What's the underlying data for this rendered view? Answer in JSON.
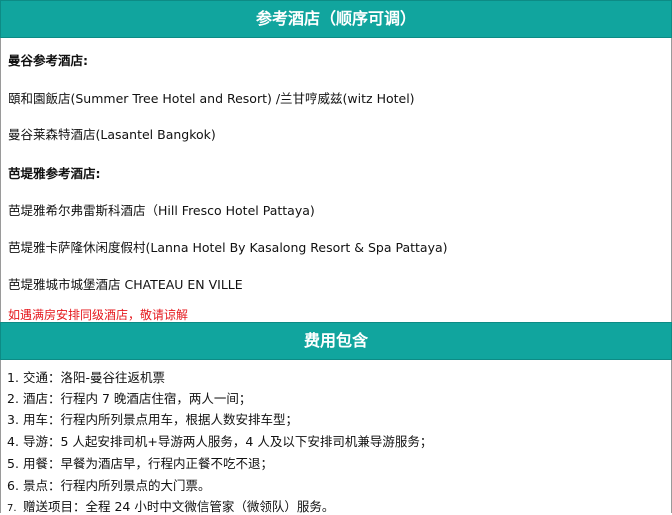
{
  "hotels": {
    "header": "参考酒店（顺序可调）",
    "bangkok_title": "曼谷参考酒店:",
    "bangkok_hotel_1": "頤和園飯店(Summer Tree Hotel and Resort) /兰甘哼威兹(witz   Hotel)",
    "bangkok_hotel_2": "曼谷莱森特酒店(Lasantel Bangkok)",
    "pattaya_title": "芭堤雅参考酒店:",
    "pattaya_hotel_1": "芭堤雅希尔弗雷斯科酒店（Hill Fresco Hotel Pattaya)",
    "pattaya_hotel_2": "芭堤雅卡萨隆休闲度假村(Lanna Hotel By Kasalong Resort & Spa Pattaya)",
    "pattaya_hotel_3": "芭堤雅城市城堡酒店 CHATEAU EN VILLE",
    "note": "如遇满房安排同级酒店，敬请谅解"
  },
  "fees": {
    "header": "费用包含",
    "items": [
      {
        "num": "1.",
        "text": "交通：洛阳-曼谷往返机票"
      },
      {
        "num": "2.",
        "text": "酒店：行程内 7 晚酒店住宿，两人一间；"
      },
      {
        "num": "3.",
        "text": "用车：行程内所列景点用车，根据人数安排车型；"
      },
      {
        "num": "4.",
        "text": "导游：5 人起安排司机+导游两人服务，4 人及以下安排司机兼导游服务；"
      },
      {
        "num": "5.",
        "text": "用餐：早餐为酒店早，行程内正餐不吃不退；"
      },
      {
        "num": "6.",
        "text": "景点：行程内所列景点的大门票。"
      },
      {
        "num": "7.",
        "text": "赠送项目：全程 24 小时中文微信管家（微领队）服务。"
      }
    ]
  },
  "colors": {
    "header_bg": "#11a59e",
    "note_red": "#e5191e"
  }
}
